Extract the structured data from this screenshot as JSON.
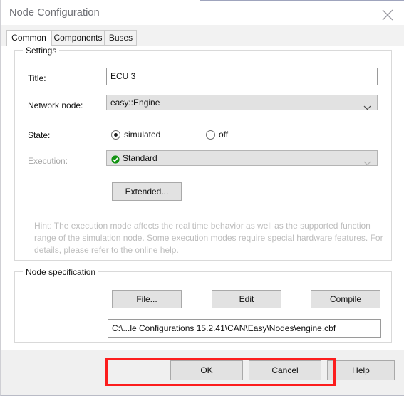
{
  "window": {
    "title": "Node Configuration",
    "close_icon": "close-icon",
    "accent_color": "#9fa4bd"
  },
  "tabs": [
    {
      "label": "Common",
      "active": true
    },
    {
      "label": "Components",
      "active": false
    },
    {
      "label": "Buses",
      "active": false
    }
  ],
  "settings": {
    "group_label": "Settings",
    "title": {
      "label": "Title:",
      "value": "ECU 3"
    },
    "network_node": {
      "label": "Network node:",
      "value": "easy::Engine",
      "icon": "chevron-down-icon"
    },
    "state": {
      "label": "State:",
      "options": [
        {
          "label": "simulated",
          "selected": true
        },
        {
          "label": "off",
          "selected": false
        }
      ]
    },
    "execution": {
      "label": "Execution:",
      "value": "Standard",
      "status_icon": "green-check-icon",
      "status_color": "#149414",
      "disabled": true,
      "icon": "chevron-down-icon"
    },
    "extended_button": "Extended...",
    "hint": "Hint: The execution mode affects the real time behavior as well as the supported function range of the simulation node. Some execution modes require special hardware features. For details, please refer to the online help."
  },
  "node_specification": {
    "group_label": "Node specification",
    "buttons": [
      {
        "accel": "F",
        "rest": "ile..."
      },
      {
        "accel": "E",
        "rest": "dit"
      },
      {
        "accel": "C",
        "rest": "ompile"
      }
    ],
    "path_value": "C:\\...le Configurations 15.2.41\\CAN\\Easy\\Nodes\\engine.cbf",
    "path_placeholder": "",
    "highlight_color": "#fc1d1d"
  },
  "footer": {
    "buttons": [
      {
        "label": "OK"
      },
      {
        "label": "Cancel"
      },
      {
        "label": "Help"
      }
    ]
  }
}
